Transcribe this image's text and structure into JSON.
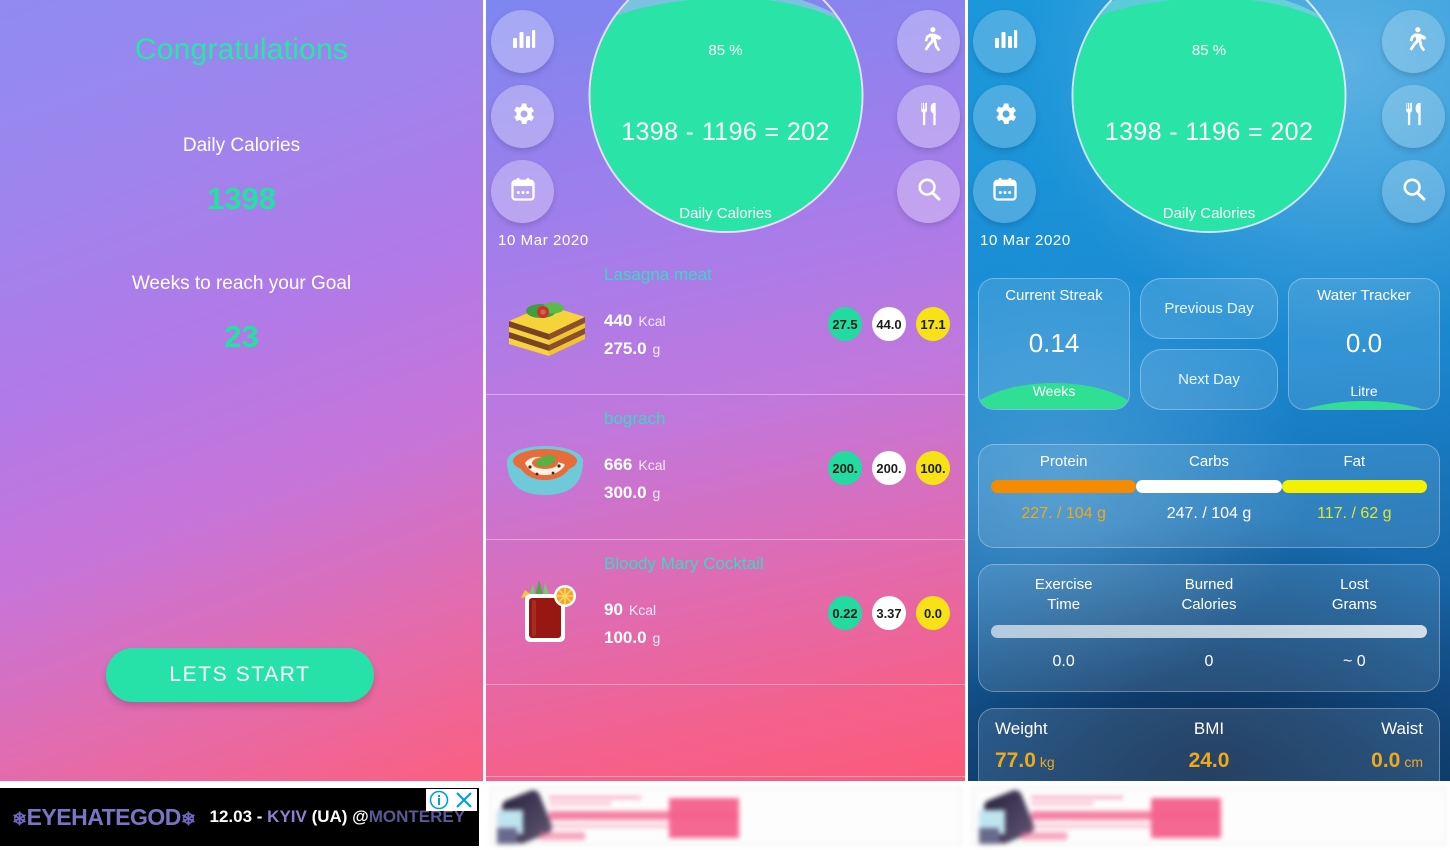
{
  "panel1": {
    "congrats": "Congratulations",
    "daily_calories_label": "Daily Calories",
    "daily_calories_value": "1398",
    "weeks_label": "Weeks to reach your Goal",
    "weeks_value": "23",
    "start_button": "LETS START",
    "accent_green": "#27e2a8"
  },
  "ad_banner": {
    "band": "EYEHATEGOD",
    "info_date": "12.03 - ",
    "info_city": "KYIV",
    "info_country": " (UA) @",
    "info_venue": "MONTEREY",
    "info_icon": "ad-choices-icon",
    "close_icon": "close-icon"
  },
  "app": {
    "date": "10  Mar  2020",
    "gauge": {
      "percent": "85 %",
      "equation": "1398 - 1196 = 202",
      "caption": "Daily Calories",
      "fill_color": "#2ae3a6"
    },
    "left_buttons": [
      {
        "name": "stats-icon",
        "label": "Statistics"
      },
      {
        "name": "gear-icon",
        "label": "Settings"
      },
      {
        "name": "calendar-icon",
        "label": "Calendar"
      }
    ],
    "right_buttons": [
      {
        "name": "running-icon",
        "label": "Exercise"
      },
      {
        "name": "cutlery-icon",
        "label": "Food"
      },
      {
        "name": "search-icon",
        "label": "Search"
      }
    ]
  },
  "panel2": {
    "foods": [
      {
        "name": "Lasagna meat",
        "kcal": "440",
        "kcal_unit": "Kcal",
        "grams": "275.0",
        "grams_unit": "g",
        "protein": "27.5",
        "carbs": "44.0",
        "fat": "17.1",
        "thumb": "lasagna-icon"
      },
      {
        "name": "bograch",
        "kcal": "666",
        "kcal_unit": "Kcal",
        "grams": "300.0",
        "grams_unit": "g",
        "protein": "200.",
        "carbs": "200.",
        "fat": "100.",
        "thumb": "soup-bowl-icon"
      },
      {
        "name": "Bloody Mary Cocktail",
        "kcal": "90",
        "kcal_unit": "Kcal",
        "grams": "100.0",
        "grams_unit": "g",
        "protein": "0.22",
        "carbs": "3.37",
        "fat": "0.0",
        "thumb": "cocktail-icon"
      }
    ],
    "badge_colors": {
      "protein": "#23dba0",
      "carbs": "#ffffff",
      "fat": "#f7e117"
    }
  },
  "panel3": {
    "streak": {
      "title": "Current Streak",
      "value": "0.14",
      "unit": "Weeks"
    },
    "water": {
      "title": "Water Tracker",
      "value": "0.0",
      "unit": "Litre"
    },
    "nav": {
      "previous": "Previous Day",
      "next": "Next Day"
    },
    "macros": {
      "headers": [
        "Protein",
        "Carbs",
        "Fat"
      ],
      "values": [
        "227. / 104 g",
        "247. / 104 g",
        "117. / 62 g"
      ],
      "bar_colors": [
        "#f48b00",
        "#ffffff",
        "#f3f000"
      ],
      "value_colors": [
        "#f0a91a",
        "#ffffff",
        "#dbe832"
      ]
    },
    "exercise": {
      "headers": [
        "Exercise\nTime",
        "Burned\nCalories",
        "Lost\nGrams"
      ],
      "header_lines": [
        [
          "Exercise",
          "Time"
        ],
        [
          "Burned",
          "Calories"
        ],
        [
          "Lost",
          "Grams"
        ]
      ],
      "values": [
        "0.0",
        "0",
        "~ 0"
      ]
    },
    "body": {
      "headers": [
        "Weight",
        "BMI",
        "Waist"
      ],
      "values": [
        "77.0",
        "24.0",
        "0.0"
      ],
      "units": [
        "kg",
        "",
        "cm"
      ]
    }
  }
}
